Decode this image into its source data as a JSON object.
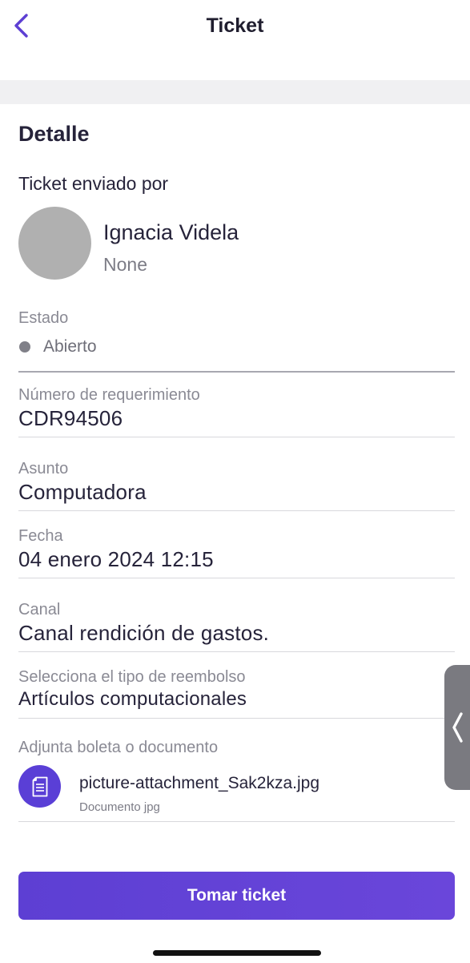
{
  "header": {
    "title": "Ticket",
    "back_icon": "chevron-left-icon"
  },
  "colors": {
    "accent": "#5d3fd3",
    "status_dot": "#808088",
    "avatar": "#b0b0b0"
  },
  "detail": {
    "section_title": "Detalle",
    "sent_by_label": "Ticket enviado por",
    "user": {
      "name": "Ignacia Videla",
      "subtitle": "None"
    }
  },
  "fields": {
    "estado": {
      "label": "Estado",
      "value": "Abierto"
    },
    "numero": {
      "label": "Número de requerimiento",
      "value": "CDR94506"
    },
    "asunto": {
      "label": "Asunto",
      "value": "Computadora"
    },
    "fecha": {
      "label": "Fecha",
      "value": "04 enero 2024 12:15"
    },
    "canal": {
      "label": "Canal",
      "value": "Canal rendición de gastos."
    },
    "tipo": {
      "label": "Selecciona el tipo de reembolso",
      "value": "Artículos computacionales"
    }
  },
  "attachment": {
    "label": "Adjunta boleta o documento",
    "file_name": "picture-attachment_Sak2kza.jpg",
    "file_type": "Documento jpg",
    "icon": "document-icon"
  },
  "actions": {
    "take_ticket": "Tomar ticket"
  },
  "side_handle": {
    "icon": "chevron-left-icon"
  }
}
